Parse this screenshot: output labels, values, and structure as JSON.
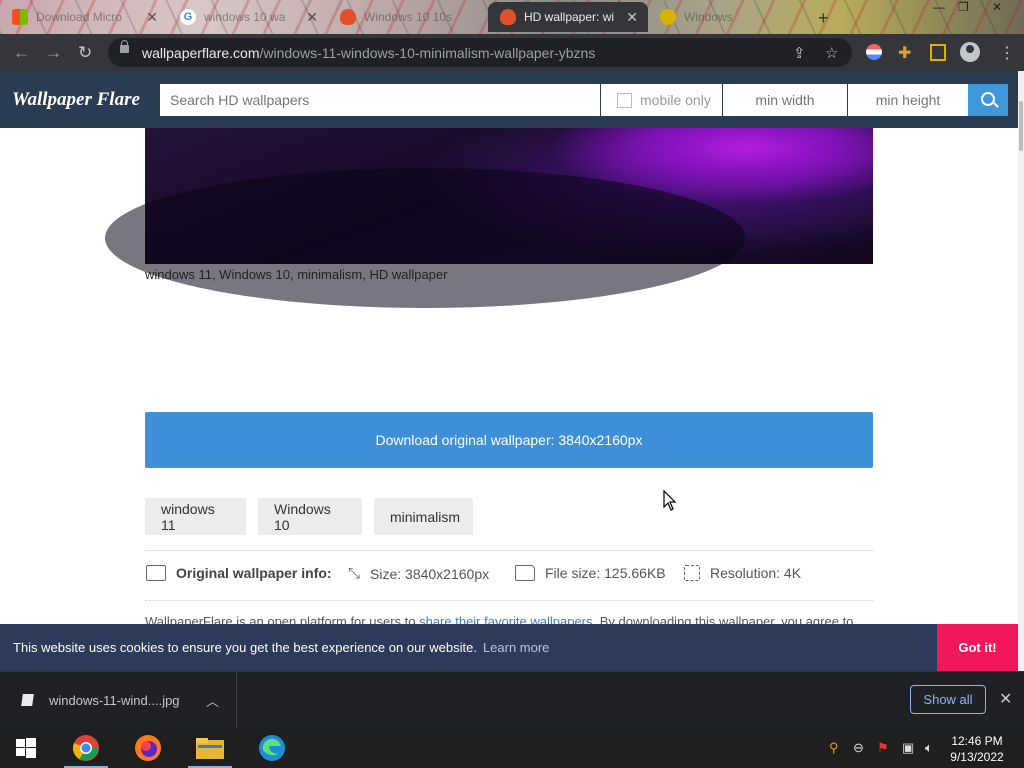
{
  "browser": {
    "tabs": [
      {
        "title": "Download Micro",
        "favicon": "microsoft-logo-icon",
        "active": false
      },
      {
        "title": "windows 10 wa",
        "favicon": "google-icon",
        "active": false
      },
      {
        "title": "Windows 10 10s",
        "favicon": "wallpaper-flare-icon",
        "active": false
      },
      {
        "title": "HD wallpaper: wi",
        "favicon": "wallpaper-flare-icon",
        "active": true
      },
      {
        "title": "Windows",
        "favicon": "yellow-site-icon",
        "active": false
      }
    ],
    "url_host": "wallpaperflare.com",
    "url_path": "/windows-11-windows-10-minimalism-wallpaper-ybzns"
  },
  "site": {
    "logo": "Wallpaper Flare",
    "search_placeholder": "Search HD wallpapers",
    "mobile_only_label": "mobile only",
    "min_width_placeholder": "min width",
    "min_height_placeholder": "min height"
  },
  "content": {
    "caption": "windows 11, Windows 10, minimalism, HD wallpaper",
    "download_label": "Download original wallpaper: 3840x2160px",
    "tags": [
      "windows 11",
      "Windows 10",
      "minimalism"
    ],
    "info_label": "Original wallpaper info:",
    "size": "Size: 3840x2160px",
    "file_size": "File size: 125.66KB",
    "resolution": "Resolution: 4K",
    "desc_prefix": "WallpaperFlare is an open platform for users to ",
    "desc_link": "share their favorite wallpapers",
    "desc_suffix": ". By downloading this wallpaper, you agree to"
  },
  "cookie": {
    "message": "This website uses cookies to ensure you get the best experience on our website.",
    "learn_more": "Learn more",
    "button": "Got it!"
  },
  "downloads": {
    "file_name": "windows-11-wind....jpg",
    "show_all": "Show all"
  },
  "taskbar": {
    "time": "12:46 PM",
    "date": "9/13/2022"
  }
}
